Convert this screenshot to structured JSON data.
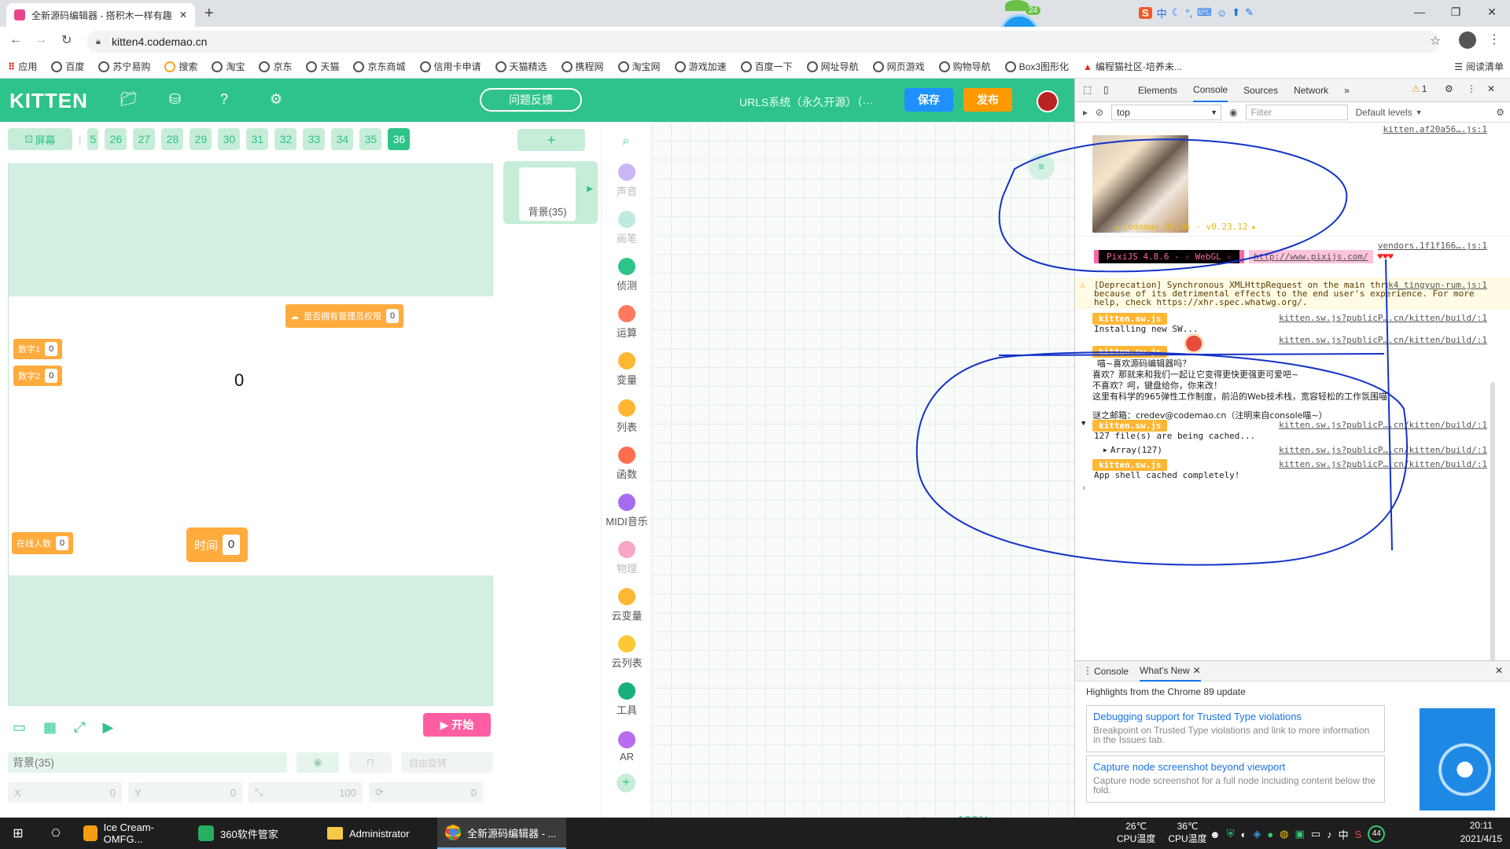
{
  "browser": {
    "tab_title": "全新源码编辑器 - 搭积木一样有趣",
    "url": "kitten4.codemao.cn",
    "bookmarks": [
      "应用",
      "百度",
      "苏宁易购",
      "搜索",
      "淘宝",
      "京东",
      "天猫",
      "京东商城",
      "信用卡申请",
      "天猫精选",
      "携程网",
      "淘宝网",
      "游戏加速",
      "百度一下",
      "网址导航",
      "网页游戏",
      "购物导航",
      "Box3图形化",
      "编程猫社区-培养未..."
    ],
    "reading_list": "阅读清单",
    "sogou_label": "中",
    "badge_count": "24"
  },
  "app": {
    "logo": "KITTEN",
    "feedback": "问题反馈",
    "project_name": "URLS系统（永久开源）（···",
    "save": "保存",
    "publish": "发布",
    "screen_btn": "屏幕",
    "scene_numbers": [
      "5",
      "26",
      "27",
      "28",
      "29",
      "30",
      "31",
      "32",
      "33",
      "34",
      "35",
      "36"
    ],
    "active_scene": "36",
    "vars": {
      "num1_label": "数字1",
      "num1_val": "0",
      "num2_label": "数字2",
      "num2_val": "0",
      "admin_label": "是否拥有管理员权限",
      "admin_val": "0",
      "center_val": "0",
      "online_label": "在线人数",
      "online_val": "0",
      "time_label": "时间",
      "time_val": "0"
    },
    "start": "开始",
    "bg_field": "背景(35)",
    "free_rotate": "自由旋转",
    "coords": {
      "x_label": "X",
      "x": "0",
      "y_label": "Y",
      "y": "0",
      "size": "100",
      "rot": "0"
    },
    "add_sprite": "+",
    "bg_card": "背景(35)",
    "categories": [
      {
        "label": "声音",
        "color": "#c9b6f5",
        "dim": true
      },
      {
        "label": "画笔",
        "color": "#bfe9e1",
        "dim": true
      },
      {
        "label": "侦测",
        "color": "#2ec38a",
        "dim": false
      },
      {
        "label": "运算",
        "color": "#ff7a5c",
        "dim": false
      },
      {
        "label": "变量",
        "color": "#ffb733",
        "dim": false
      },
      {
        "label": "列表",
        "color": "#ffb733",
        "dim": false
      },
      {
        "label": "函数",
        "color": "#ff6e4d",
        "dim": false
      },
      {
        "label": "MIDI音乐",
        "color": "#a66cf0",
        "dim": false
      },
      {
        "label": "物理",
        "color": "#f7a6c8",
        "dim": true
      },
      {
        "label": "云变量",
        "color": "#ffb733",
        "dim": false
      },
      {
        "label": "云列表",
        "color": "#ffc933",
        "dim": false
      },
      {
        "label": "工具",
        "color": "#16b07a",
        "dim": false
      },
      {
        "label": "AR",
        "color": "#b96cf0",
        "dim": false
      }
    ],
    "zoom": "100%"
  },
  "devtools": {
    "tabs": [
      "Elements",
      "Console",
      "Sources",
      "Network"
    ],
    "active_tab": "Console",
    "warn_count": "1",
    "context": "top",
    "filter_placeholder": "Filter",
    "levels": "Default levels",
    "logs": {
      "src1": "kitten.af20a56….js:1",
      "banner": "Codemao Blink - v0.23.12",
      "src2": "vendors.1f1f166….js:1",
      "pixi": "PixiJS 4.8.6 - ☆ WebGL ☆",
      "pixi_url": "http://www.pixijs.com/",
      "hearts": "♥♥♥",
      "warn_src": "k4_tingyun-rum.js:1",
      "warn_text": "[Deprecation] Synchronous XMLHttpRequest on the main thread is deprecated because of its detrimental effects to the end user's experience. For more help, check https://xhr.spec.whatwg.org/.",
      "sw_src": "kitten.sw.js?publicP….cn/kitten/build/:1",
      "sw_tag": "kitten.sw.js",
      "installing": "Installing new SW...",
      "msg1": "喵~喜欢源码编辑器吗？",
      "msg2": "喜欢？那就来和我们一起让它变得更快更强更可爱吧~",
      "msg3": "不喜欢？呵，键盘给你，你来改！",
      "msg4": "这里有科学的965弹性工作制度，前沿的Web技术栈，宽容轻松的工作氛围喵",
      "mail": "谜之邮箱：credev@codemao.cn（注明来自console喵~）",
      "cached": "127 file(s) are being cached...",
      "array": "Array(127)",
      "done": "App shell cached completely!"
    },
    "drawer_tabs": [
      "Console",
      "What's New"
    ],
    "highlights": "Highlights from the Chrome 89 update",
    "cards": [
      {
        "title": "Debugging support for Trusted Type violations",
        "desc": "Breakpoint on Trusted Type violations and link to more information in the Issues tab."
      },
      {
        "title": "Capture node screenshot beyond viewport",
        "desc": "Capture node screenshot for a full node including content below the fold."
      }
    ]
  },
  "taskbar": {
    "apps": [
      "Ice Cream-OMFG...",
      "360软件管家",
      "Administrator",
      "全新源码编辑器 - ..."
    ],
    "temp1": "26℃",
    "temp1_label": "CPU温度",
    "temp2": "36℃",
    "temp2_label": "CPU温度",
    "ime": "中",
    "cpu_pct": "44",
    "time": "20:11",
    "date": "2021/4/15"
  }
}
